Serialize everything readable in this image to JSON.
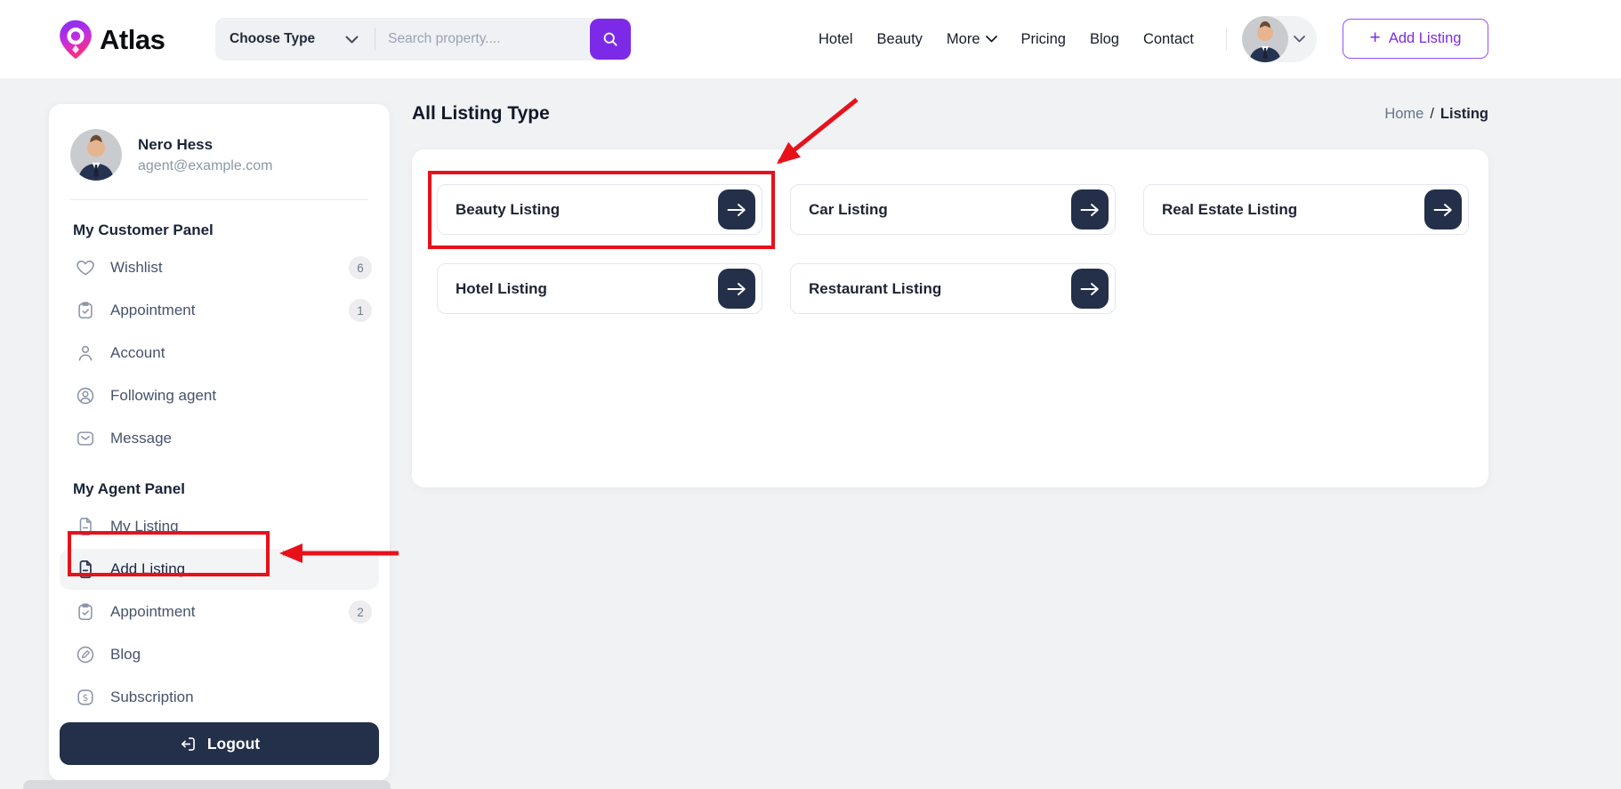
{
  "brand": {
    "name": "Atlas"
  },
  "navbar": {
    "search": {
      "type_selector": "Choose Type",
      "placeholder": "Search property...."
    },
    "links": [
      {
        "label": "Hotel"
      },
      {
        "label": "Beauty"
      },
      {
        "label": "More",
        "has_dropdown": true
      },
      {
        "label": "Pricing"
      },
      {
        "label": "Blog"
      },
      {
        "label": "Contact"
      }
    ],
    "add_listing": {
      "icon": "+",
      "label": "Add Listing"
    }
  },
  "sidebar": {
    "user": {
      "name": "Nero Hess",
      "email": "agent@example.com"
    },
    "sections": [
      {
        "title": "My Customer Panel",
        "items": [
          {
            "label": "Wishlist",
            "icon": "heart-icon",
            "badge": "6"
          },
          {
            "label": "Appointment",
            "icon": "clipboard-check-icon",
            "badge": "1"
          },
          {
            "label": "Account",
            "icon": "user-icon"
          },
          {
            "label": "Following agent",
            "icon": "user-circle-icon"
          },
          {
            "label": "Message",
            "icon": "mail-icon"
          }
        ]
      },
      {
        "title": "My Agent Panel",
        "items": [
          {
            "label": "My Listing",
            "icon": "file-icon"
          },
          {
            "label": "Add Listing",
            "icon": "file-icon",
            "active": true,
            "annotated": true
          },
          {
            "label": "Appointment",
            "icon": "clipboard-check-icon",
            "badge": "2"
          },
          {
            "label": "Blog",
            "icon": "edit-icon"
          },
          {
            "label": "Subscription",
            "icon": "dollar-icon"
          }
        ]
      }
    ],
    "logout": {
      "label": "Logout",
      "icon": "logout-icon"
    }
  },
  "main": {
    "title": "All Listing Type",
    "breadcrumb": {
      "home": "Home",
      "separator": "/",
      "current": "Listing"
    },
    "cards": [
      {
        "label": "Beauty Listing",
        "annotated": true
      },
      {
        "label": "Car Listing"
      },
      {
        "label": "Real Estate Listing"
      },
      {
        "label": "Hotel Listing"
      },
      {
        "label": "Restaurant Listing"
      }
    ]
  },
  "annotations": {
    "color": "#e8111a",
    "targets": [
      "Beauty Listing card",
      "Add Listing sidebar item"
    ]
  },
  "colors": {
    "accent": "#7d2ae8",
    "navy": "#243049",
    "page_bg": "#f1f2f4",
    "annotation_red": "#e8111a"
  }
}
